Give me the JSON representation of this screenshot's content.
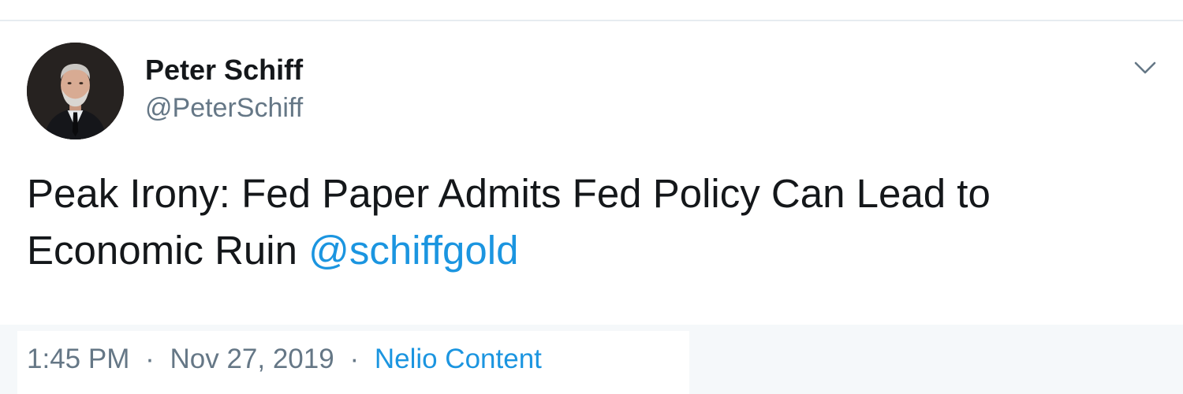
{
  "author": {
    "display_name": "Peter Schiff",
    "handle": "@PeterSchiff",
    "avatar_icon": "profile-photo"
  },
  "tweet": {
    "text_before_mention": "Peak Irony: Fed Paper Admits Fed Policy Can Lead to Economic Ruin ",
    "mention": "@schiffgold"
  },
  "meta": {
    "time": "1:45 PM",
    "separator_1": "·",
    "date": "Nov 27, 2019",
    "separator_2": "·",
    "source": "Nelio Content"
  },
  "icons": {
    "caret": "chevron-down-icon"
  },
  "colors": {
    "link": "#1b95e0",
    "text": "#14171a",
    "secondary": "#657786",
    "divider": "#e6ecf0"
  }
}
